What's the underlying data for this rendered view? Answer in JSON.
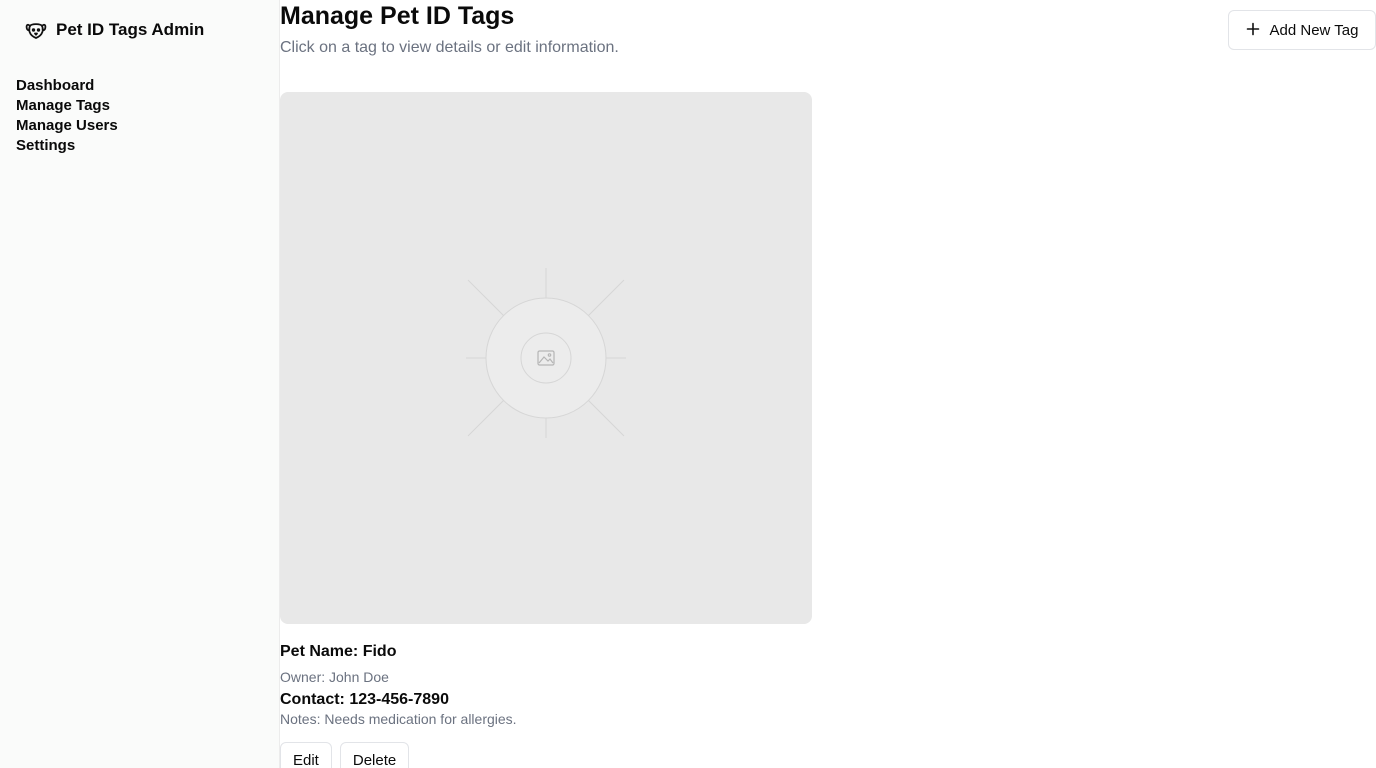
{
  "app": {
    "title": "Pet ID Tags Admin",
    "icon": "dog-face-icon"
  },
  "sidebar": {
    "items": [
      {
        "label": "Dashboard"
      },
      {
        "label": "Manage Tags"
      },
      {
        "label": "Manage Users"
      },
      {
        "label": "Settings"
      }
    ]
  },
  "header": {
    "title": "Manage Pet ID Tags",
    "subtitle": "Click on a tag to view details or edit information.",
    "add_button": {
      "label": "Add New Tag",
      "icon": "plus-icon"
    }
  },
  "tag": {
    "image_icon": "image-placeholder-icon",
    "pet_name": "Pet Name: Fido",
    "owner": "Owner: John Doe",
    "contact": "Contact: 123-456-7890",
    "notes": "Notes: Needs medication for allergies.",
    "edit_label": "Edit",
    "delete_label": "Delete"
  },
  "colors": {
    "sidebar_bg": "#fafbfa",
    "muted_text": "#6b7280",
    "placeholder_bg": "#e8e8e8",
    "border": "#e2e4e8"
  }
}
